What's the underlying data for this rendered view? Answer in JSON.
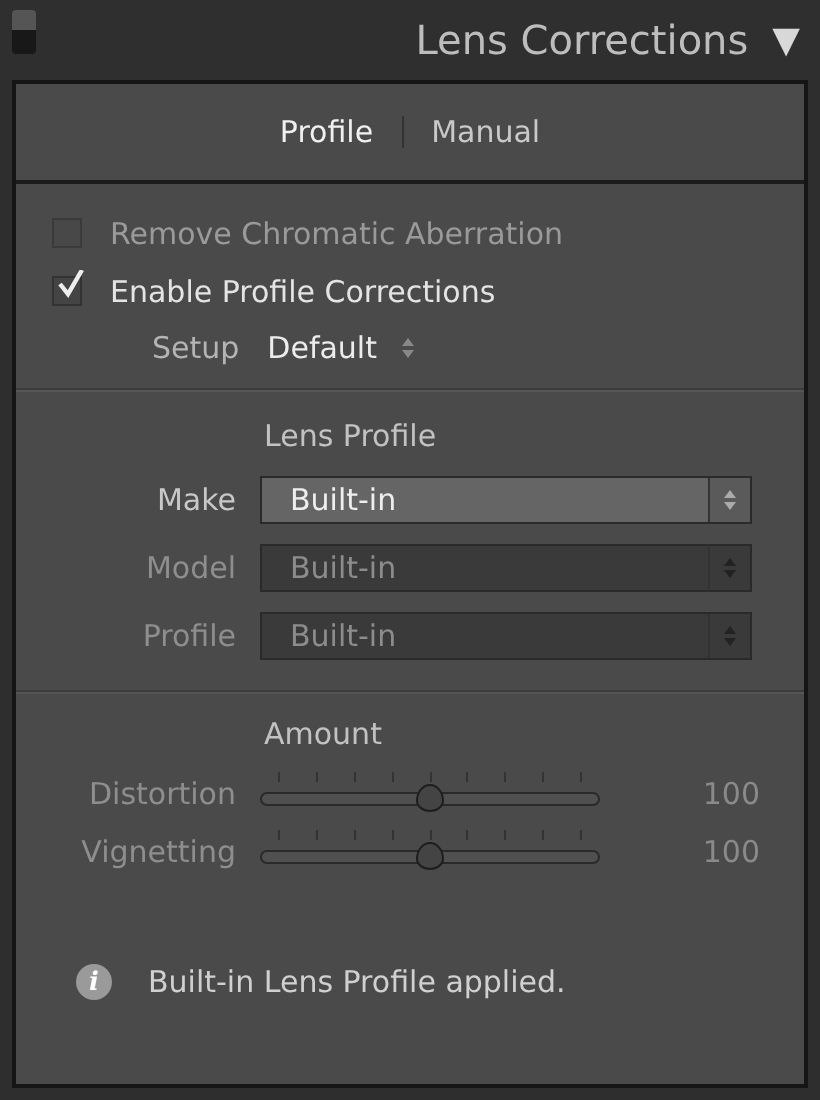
{
  "panel": {
    "title": "Lens Corrections",
    "collapse_icon": "▼",
    "switch_on": true
  },
  "tabs": [
    {
      "label": "Profile",
      "selected": true
    },
    {
      "label": "Manual",
      "selected": false
    }
  ],
  "options": [
    {
      "label": "Remove Chromatic Aberration",
      "checked": false,
      "disabled": true
    },
    {
      "label": "Enable Profile Corrections",
      "checked": true,
      "disabled": false
    }
  ],
  "setup": {
    "label": "Setup",
    "value": "Default"
  },
  "lens_profile": {
    "heading": "Lens Profile",
    "fields": [
      {
        "label": "Make",
        "value": "Built-in",
        "disabled": false
      },
      {
        "label": "Model",
        "value": "Built-in",
        "disabled": true
      },
      {
        "label": "Profile",
        "value": "Built-in",
        "disabled": true
      }
    ]
  },
  "amount": {
    "heading": "Amount",
    "sliders": [
      {
        "label": "Distortion",
        "level": 0.5,
        "reading": "100",
        "disabled": true
      },
      {
        "label": "Vignetting",
        "level": 0.5,
        "reading": "100",
        "disabled": true
      }
    ]
  },
  "info": {
    "icon": "i",
    "message": "Built-in Lens Profile applied."
  }
}
